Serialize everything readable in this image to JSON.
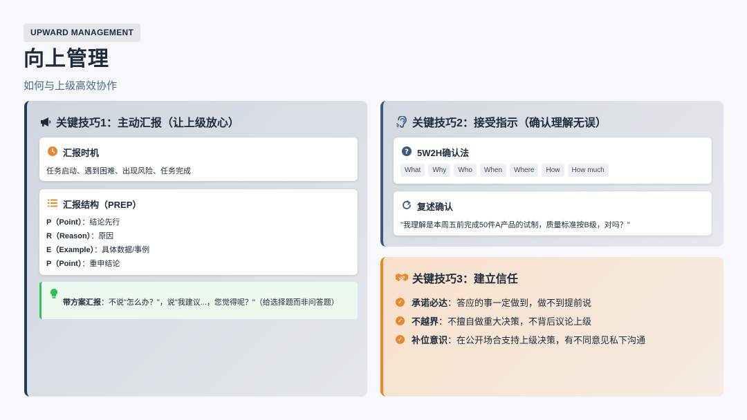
{
  "header": {
    "tag": "UPWARD MANAGEMENT",
    "title": "向上管理",
    "subtitle": "如何与上级高效协作"
  },
  "skill1": {
    "title": "关键技巧1：主动汇报（让上级放心）",
    "icon": "megaphone-icon",
    "timing": {
      "title": "汇报时机",
      "icon": "clock-icon",
      "text": "任务启动、遇到困难、出现风险、任务完成"
    },
    "structure": {
      "title": "汇报结构（PREP）",
      "icon": "list-icon",
      "lines": [
        {
          "key": "P（Point）",
          "sep": "：",
          "val": "结论先行"
        },
        {
          "key": "R（Reason）",
          "sep": "：",
          "val": "原因"
        },
        {
          "key": "E（Example）",
          "sep": "：",
          "val": "具体数据/事例"
        },
        {
          "key": "P（Point）",
          "sep": "：",
          "val": "重申结论"
        }
      ]
    },
    "tip": {
      "icon": "lightbulb-icon",
      "label": "带方案汇报",
      "text": "：不说\"怎么办？\"，说\"我建议...，您觉得呢？\"（给选择题而非问答题）"
    }
  },
  "skill2": {
    "title": "关键技巧2：接受指示（确认理解无误）",
    "icon": "ear-icon",
    "w2h": {
      "title": "5W2H确认法",
      "icon": "question-circle-icon",
      "chips": [
        "What",
        "Why",
        "Who",
        "When",
        "Where",
        "How",
        "How much"
      ]
    },
    "restate": {
      "title": "复述确认",
      "icon": "redo-icon",
      "text": "\"我理解是本周五前完成50件A产品的试制，质量标准按B级，对吗？\""
    }
  },
  "skill3": {
    "title": "关键技巧3：建立信任",
    "icon": "handshake-icon",
    "items": [
      {
        "label": "承诺必达",
        "text": "：答应的事一定做到，做不到提前说"
      },
      {
        "label": "不越界",
        "text": "：不擅自做重大决策，不背后议论上级"
      },
      {
        "label": "补位意识",
        "text": "：在公开场合支持上级决策，有不同意见私下沟通"
      }
    ]
  },
  "colors": {
    "navy": "#243a54",
    "orange": "#e8892e",
    "green": "#2ec15a",
    "slate": "#3c5a7c"
  }
}
